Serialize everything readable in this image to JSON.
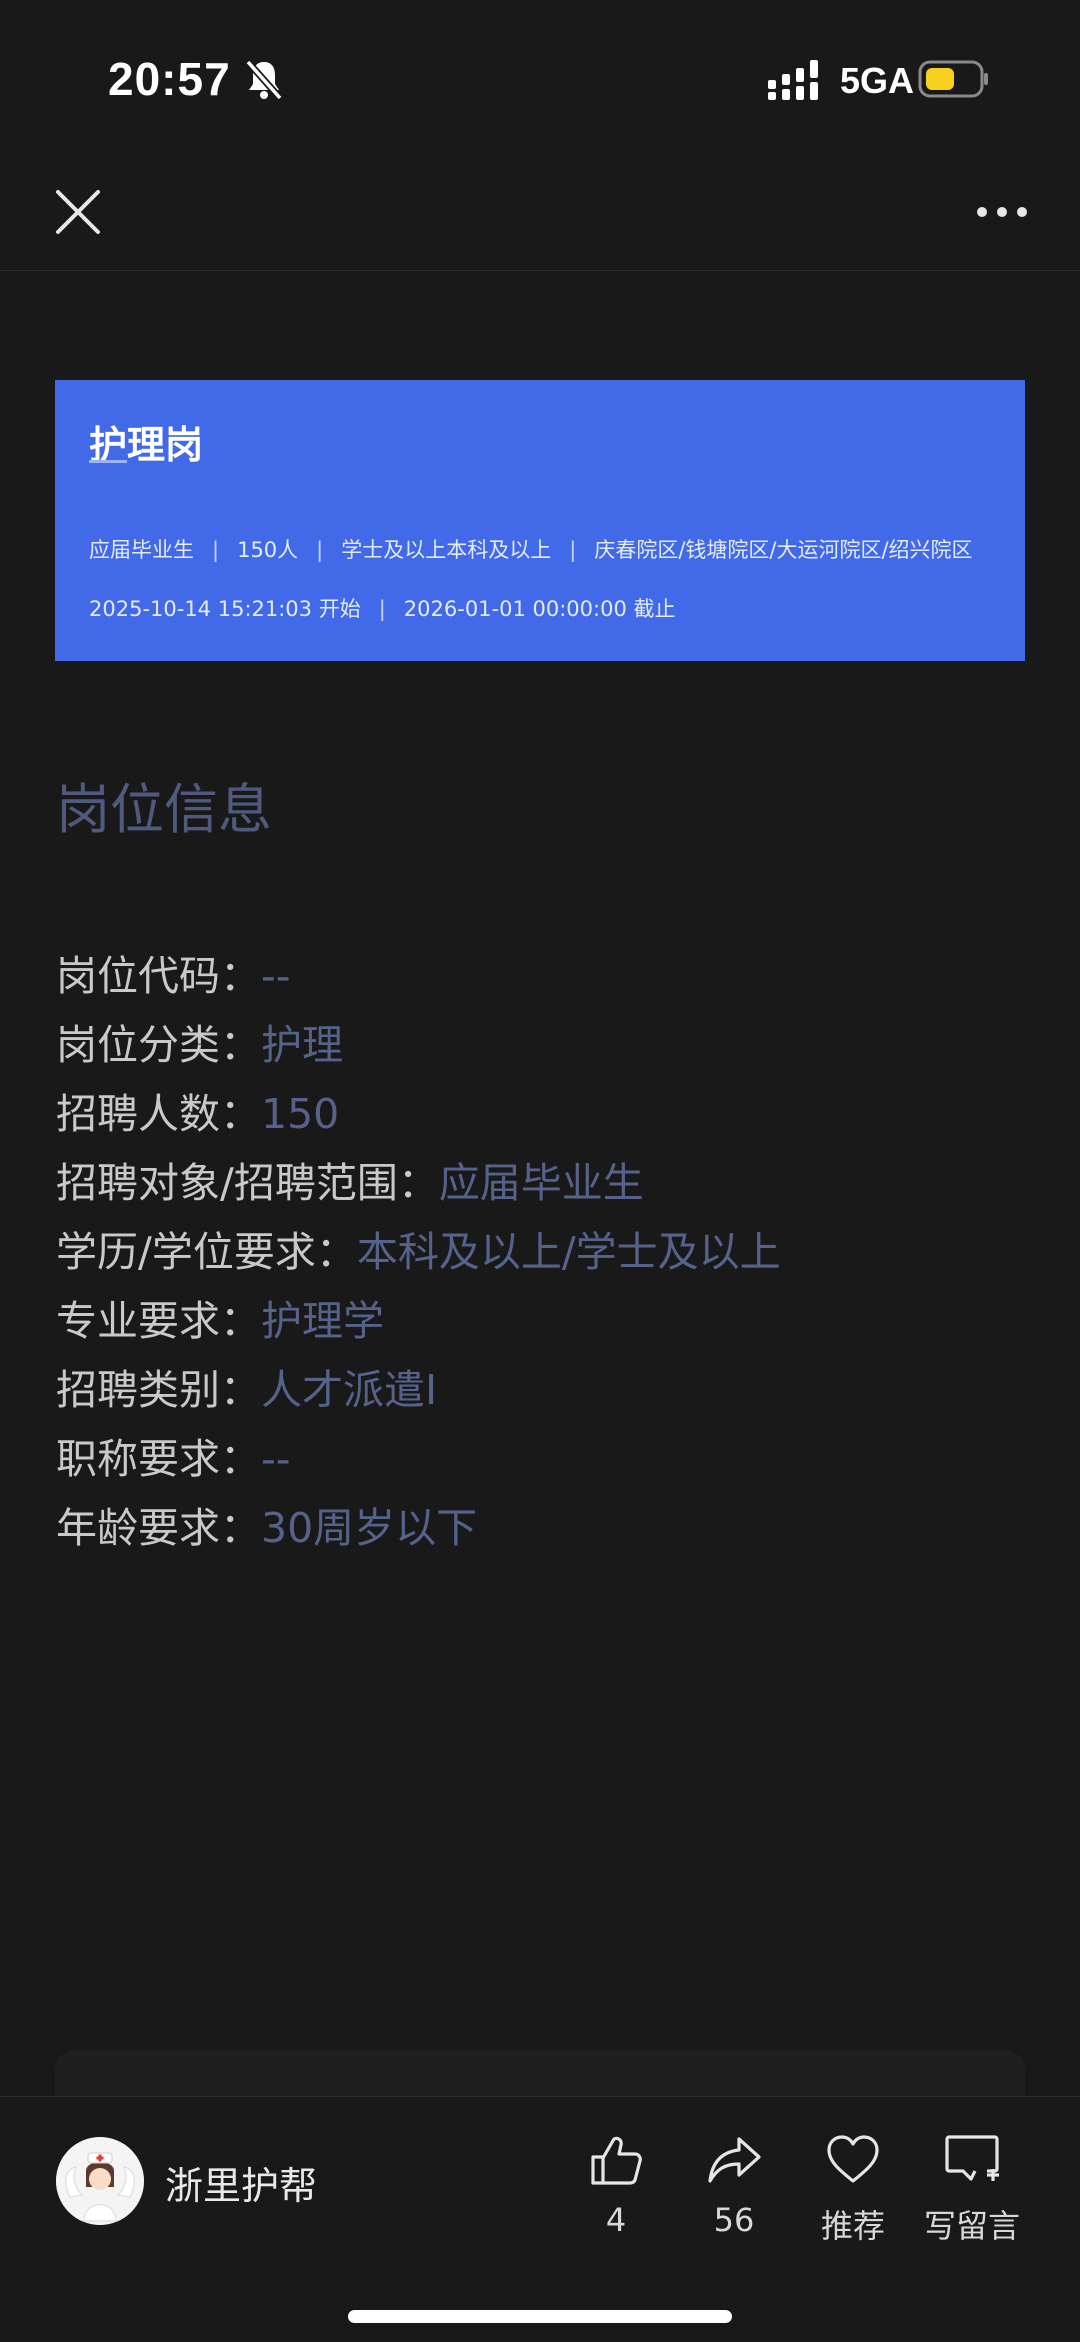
{
  "status_bar": {
    "time": "20:57",
    "network": "5GA",
    "battery_color": "#f5d01c",
    "icons": [
      "bell-off-icon",
      "signal-icon",
      "battery-icon"
    ]
  },
  "nav": {
    "close_icon": "close-icon",
    "more_icon": "more-icon"
  },
  "banner": {
    "title": "护理岗",
    "meta": [
      "应届毕业生",
      "150人",
      "学士及以上本科及以上",
      "庆春院区/钱塘院区/大运河院区/绍兴院区"
    ],
    "dates": [
      "2025-10-14 15:21:03 开始",
      "2026-01-01 00:00:00 截止"
    ],
    "background": "#4169e8"
  },
  "section": {
    "title": "岗位信息"
  },
  "info": [
    {
      "key": "岗位代码：",
      "value": "--"
    },
    {
      "key": "岗位分类：",
      "value": "护理"
    },
    {
      "key": "招聘人数：",
      "value": "150"
    },
    {
      "key": "招聘对象/招聘范围：",
      "value": "应届毕业生"
    },
    {
      "key": "学历/学位要求：",
      "value": "本科及以上/学士及以上"
    },
    {
      "key": "专业要求：",
      "value": "护理学"
    },
    {
      "key": "招聘类别：",
      "value": "人才派遣I"
    },
    {
      "key": "职称要求：",
      "value": "--"
    },
    {
      "key": "年龄要求：",
      "value": "30周岁以下"
    }
  ],
  "bottom": {
    "account_name": "浙里护帮",
    "like_count": "4",
    "share_count": "56",
    "recommend_label": "推荐",
    "comment_label": "写留言"
  }
}
